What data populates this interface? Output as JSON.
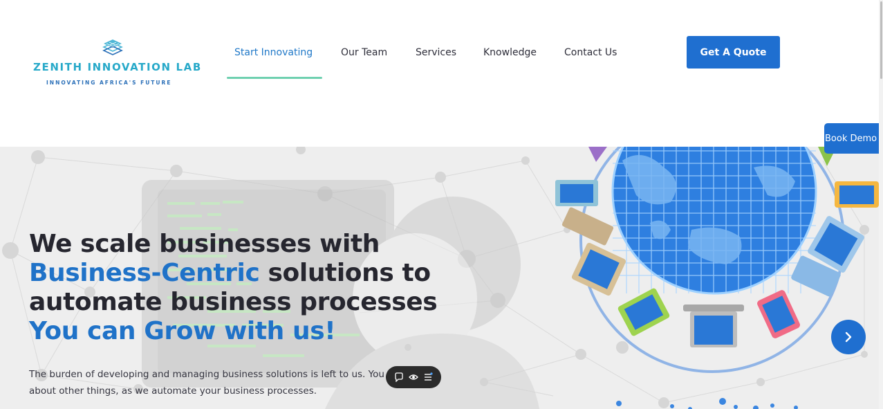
{
  "header": {
    "logo": {
      "title": "ZENITH INNOVATION LAB",
      "tagline": "INNOVATING AFRICA'S FUTURE"
    },
    "nav": [
      {
        "label": "Start Innovating",
        "active": true
      },
      {
        "label": "Our Team",
        "active": false
      },
      {
        "label": "Services",
        "active": false
      },
      {
        "label": "Knowledge",
        "active": false
      },
      {
        "label": "Contact Us",
        "active": false
      }
    ],
    "cta_label": "Get A Quote"
  },
  "side_tab": {
    "label": "Book Demo"
  },
  "hero": {
    "headline": {
      "line1": "We scale businesses with",
      "line2_highlight": "Business-Centric",
      "line2_rest": " solutions to",
      "line3": "automate business processes",
      "line4": "You can Grow with us!"
    },
    "subtext": "The burden of developing and managing business solutions is left to us. You can worry about other things, as we automate your business processes.",
    "next_icon": "chevron-right-icon"
  },
  "floating_toolbar": {
    "icons": [
      "comment-icon",
      "eye-icon",
      "menu-icon"
    ]
  },
  "colors": {
    "brand_blue": "#1f6fd0",
    "heading_blue": "#1f72c8",
    "logo_teal": "#27a9c9",
    "nav_underline": "#6fd0b0",
    "heading_dark": "#26262f"
  }
}
